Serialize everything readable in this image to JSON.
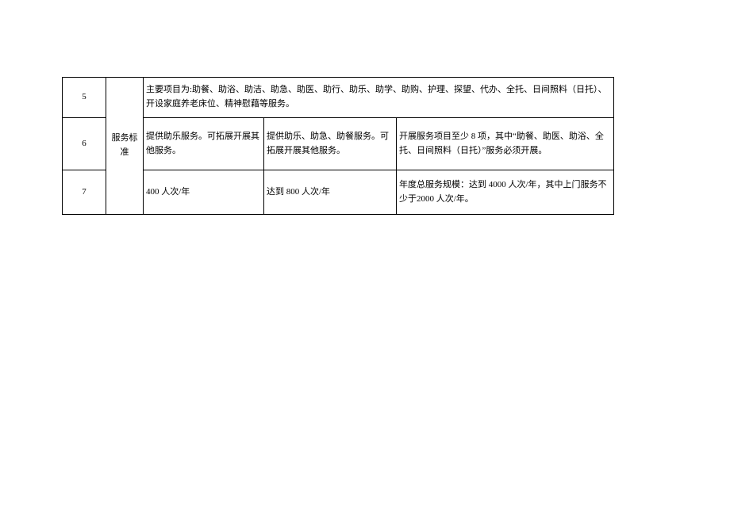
{
  "rows": {
    "r5": {
      "idx": "5",
      "merged": "主要项目为:助餐、助浴、助洁、助急、助医、助行、助乐、助学、助购、护理、探望、代办、全托、日间照料（日托）、开设家庭养老床位、精神慰藉等服务。"
    },
    "category": "服务标准",
    "r6": {
      "idx": "6",
      "a": "提供助乐服务。可拓展开展其他服务。",
      "b": "提供助乐、助急、助餐服务。可拓展开展其他服务。",
      "c": "开展服务项目至少 8 项，其中“助餐、助医、助浴、全托、日间照料（日托）”服务必须开展。"
    },
    "r7": {
      "idx": "7",
      "a": "400 人次/年",
      "b": "达到 800 人次/年",
      "c": "年度总服务规模：达到 4000 人次/年，其中上门服务不少于2000 人次/年。"
    }
  }
}
